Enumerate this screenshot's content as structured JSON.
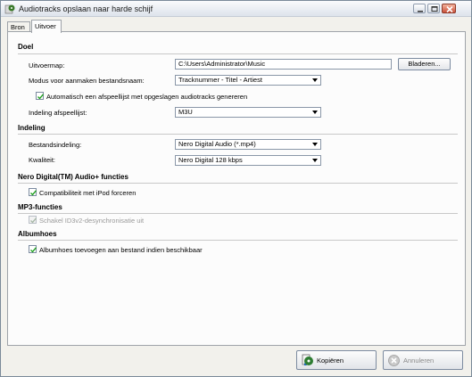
{
  "window": {
    "title": "Audiotracks opslaan naar harde schijf"
  },
  "tabs": [
    {
      "label": "Bron"
    },
    {
      "label": "Uitvoer"
    }
  ],
  "doel": {
    "heading": "Doel",
    "output_folder_label": "Uitvoermap:",
    "output_folder_value": "C:\\Users\\Administrator\\Music",
    "browse_label": "Bladeren...",
    "naming_mode_label": "Modus voor aanmaken bestandsnaam:",
    "naming_mode_value": "Tracknummer - Titel - Artiest",
    "auto_playlist_label": "Automatisch een afspeellijst met opgeslagen audiotracks genereren",
    "auto_playlist_checked": true,
    "playlist_format_label": "Indeling afspeellijst:",
    "playlist_format_value": "M3U"
  },
  "indeling": {
    "heading": "Indeling",
    "file_format_label": "Bestandsindeling:",
    "file_format_value": "Nero Digital Audio (*.mp4)",
    "quality_label": "Kwaliteit:",
    "quality_value": "Nero Digital 128 kbps"
  },
  "nero_digital": {
    "heading": "Nero Digital(TM) Audio+ functies",
    "ipod_label": "Compatibiliteit met iPod forceren",
    "ipod_checked": true
  },
  "mp3": {
    "heading": "MP3-functies",
    "id3_label": "Schakel ID3v2-desynchronisatie uit",
    "id3_checked": true,
    "id3_disabled": true
  },
  "albumhoes": {
    "heading": "Albumhoes",
    "cover_label": "Albumhoes toevoegen aan bestand indien beschikbaar",
    "cover_checked": true
  },
  "footer": {
    "copy_label": "Kopiëren",
    "cancel_label": "Annuleren"
  }
}
